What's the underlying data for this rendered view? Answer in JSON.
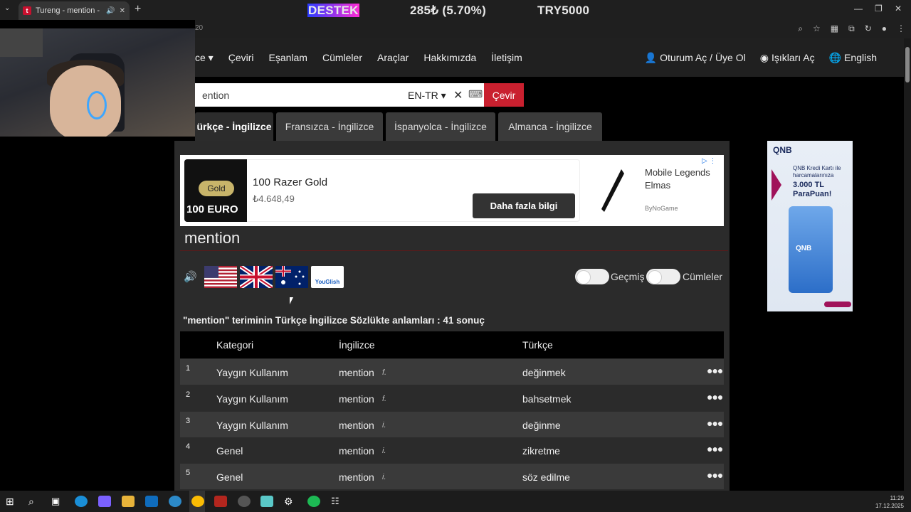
{
  "browser": {
    "tab_title": "Tureng - mention - Türkçe",
    "address_fragment": "20"
  },
  "overlay": {
    "destek": "DESTEK",
    "percent": "285₺ (5.70%)",
    "goal": "TRY5000"
  },
  "nav": {
    "first": "ce",
    "items": [
      "Çeviri",
      "Eşanlam",
      "Cümleler",
      "Araçlar",
      "Hakkımızda",
      "İletişim"
    ],
    "login": "Oturum Aç / Üye Ol",
    "lights": "Işıkları Aç",
    "language": "English"
  },
  "search": {
    "value": "ention",
    "lang": "EN-TR",
    "button": "Çevir"
  },
  "lang_tabs": [
    "ürkçe - İngilizce",
    "Fransızca - İngilizce",
    "İspanyolca - İngilizce",
    "Almanca - İngilizce"
  ],
  "ad": {
    "gold_label": "Gold",
    "euro_label": "100 EURO",
    "title": "100 Razer Gold",
    "price": "₺4.648,49",
    "button": "Daha fazla bilgi",
    "ad2_title": "Mobile Legends Elmas",
    "ad2_sub": "ByNoGame"
  },
  "word": "mention",
  "toggles": {
    "history": "Geçmiş",
    "sentences": "Cümleler"
  },
  "youglish": "YouGlish",
  "result_summary": "\"mention\" teriminin Türkçe İngilizce Sözlükte anlamları : 41 sonuç",
  "table": {
    "headers": [
      "Kategori",
      "İngilizce",
      "Türkçe"
    ],
    "rows": [
      {
        "num": "1",
        "category": "Yaygın Kullanım",
        "english": "mention",
        "pos": "f.",
        "turkish": "değinmek"
      },
      {
        "num": "2",
        "category": "Yaygın Kullanım",
        "english": "mention",
        "pos": "f.",
        "turkish": "bahsetmek"
      },
      {
        "num": "3",
        "category": "Yaygın Kullanım",
        "english": "mention",
        "pos": "i.",
        "turkish": "değinme"
      },
      {
        "num": "4",
        "category": "Genel",
        "english": "mention",
        "pos": "i.",
        "turkish": "zikretme"
      },
      {
        "num": "5",
        "category": "Genel",
        "english": "mention",
        "pos": "i.",
        "turkish": "söz edilme"
      }
    ]
  },
  "side_ad": {
    "logo": "QNB",
    "line1": "QNB Kredi Kartı ile harcamalarınıza",
    "big": "3.000 TL ParaPuan!",
    "card_logo": "QNB"
  },
  "taskbar": {
    "time": "11:29",
    "date": "17.12.2025"
  }
}
